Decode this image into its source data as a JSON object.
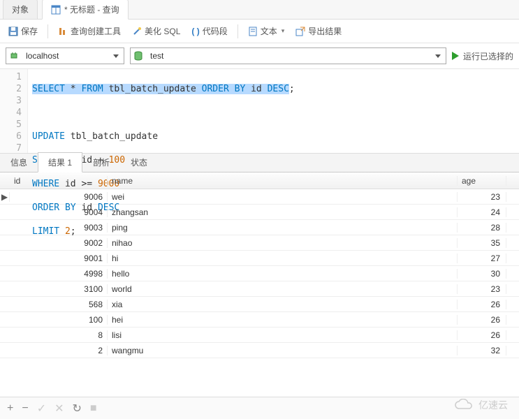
{
  "top_tabs": {
    "objects": "对象",
    "query_icon": "query-table-icon",
    "query_label": "* 无标题 - 查询"
  },
  "toolbar": {
    "save": "保存",
    "query_builder": "查询创建工具",
    "beautify_sql": "美化 SQL",
    "code_seg": "代码段",
    "text": "文本",
    "export": "导出结果"
  },
  "selectors": {
    "connection": "localhost",
    "database": "test",
    "run": "运行已选择的"
  },
  "sql": {
    "l1_a": "SELECT",
    "l1_b": " * ",
    "l1_c": "FROM",
    "l1_d": " tbl_batch_update ",
    "l1_e": "ORDER BY",
    "l1_f": " id ",
    "l1_g": "DESC",
    "l1_h": ";",
    "l3_a": "UPDATE",
    "l3_b": " tbl_batch_update",
    "l4_a": "SET",
    "l4_b": " id = id + ",
    "l4_c": "100",
    "l5_a": "WHERE",
    "l5_b": " id >= ",
    "l5_c": "9000",
    "l6_a": "ORDER BY",
    "l6_b": " id ",
    "l6_c": "DESC",
    "l7_a": "LIMIT",
    "l7_b": " ",
    "l7_c": "2",
    "l7_d": ";",
    "gutter": [
      "1",
      "2",
      "3",
      "4",
      "5",
      "6",
      "7"
    ]
  },
  "result_tabs": {
    "info": "信息",
    "result": "结果 1",
    "profile": "剖析",
    "status": "状态"
  },
  "grid": {
    "cols": {
      "id": "id",
      "name": "name",
      "age": "age"
    },
    "rows": [
      {
        "id": "9006",
        "name": "wei",
        "age": "23",
        "current": true
      },
      {
        "id": "9004",
        "name": "zhangsan",
        "age": "24"
      },
      {
        "id": "9003",
        "name": "ping",
        "age": "28"
      },
      {
        "id": "9002",
        "name": "nihao",
        "age": "35"
      },
      {
        "id": "9001",
        "name": "hi",
        "age": "27"
      },
      {
        "id": "4998",
        "name": "hello",
        "age": "30"
      },
      {
        "id": "3100",
        "name": "world",
        "age": "23"
      },
      {
        "id": "568",
        "name": "xia",
        "age": "26"
      },
      {
        "id": "100",
        "name": "hei",
        "age": "26"
      },
      {
        "id": "8",
        "name": "lisi",
        "age": "26"
      },
      {
        "id": "2",
        "name": "wangmu",
        "age": "32"
      }
    ]
  },
  "bottom": {
    "plus": "+",
    "minus": "−",
    "check": "✓",
    "x": "✕",
    "refresh": "↻",
    "stop": "■"
  },
  "watermark": "亿速云"
}
